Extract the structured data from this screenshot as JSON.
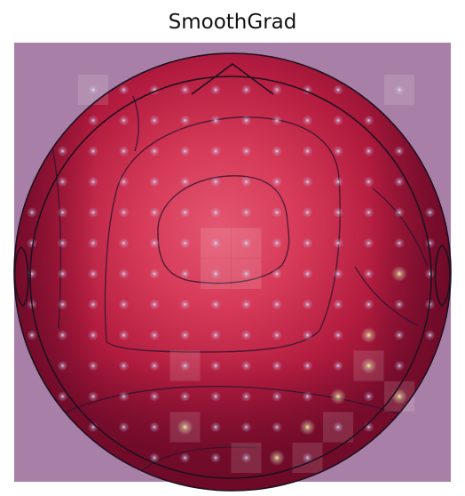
{
  "title": "SmoothGrad",
  "colors": {
    "background_tint": "#a87fa6",
    "head_low": "#8a0f32",
    "head_mid": "#c92a48",
    "head_high": "#e2506a",
    "contour": "#2e1430",
    "outline": "#1f1020",
    "saliency_dot": "#e9ecff",
    "saliency_hot": "#ffe86a"
  },
  "map": {
    "type": "eeg-topomap-saliency",
    "head": {
      "has_nose": true,
      "has_ears": true
    }
  }
}
